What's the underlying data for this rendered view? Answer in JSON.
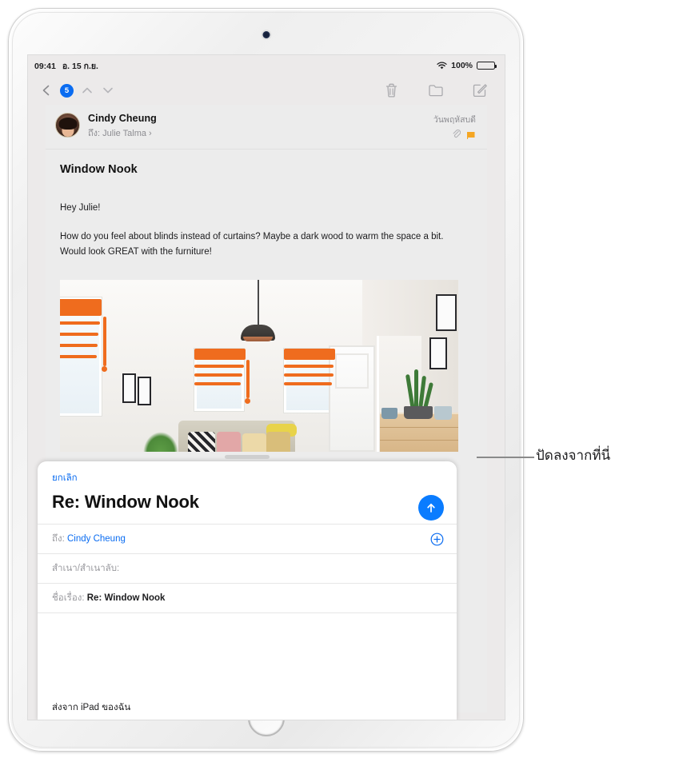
{
  "device": {
    "name": "ipad",
    "camera": "front-camera",
    "home_button": "home-button"
  },
  "status_bar": {
    "time": "09:41",
    "date": "อ. 15 ก.ย.",
    "wifi_icon": "wifi-icon",
    "battery_percent": "100%",
    "battery_icon": "battery-icon"
  },
  "toolbar": {
    "back_icon": "chevron-left-icon",
    "unread_badge": "5",
    "previous_icon": "chevron-up-icon",
    "next_icon": "chevron-down-icon",
    "trash_icon": "trash-icon",
    "folder_icon": "folder-icon",
    "compose_icon": "compose-icon"
  },
  "message": {
    "avatar": "sender-avatar",
    "sender": "Cindy Cheung",
    "to_label": "ถึง:",
    "to_name": "Julie Talma",
    "disclosure": "›",
    "date": "วันพฤหัสบดี",
    "attachment_icon": "paperclip-icon",
    "flag_icon": "flag-icon",
    "flag_color": "#f5a623",
    "subject": "Window Nook",
    "greeting": "Hey Julie!",
    "paragraph": "How do you feel about blinds instead of curtains? Maybe a dark wood to warm the space a bit. Would look GREAT with the furniture!",
    "photo_alt": "living-room-photo-with-orange-drawn-blinds"
  },
  "compose": {
    "drag_handle": "sheet-drag-handle",
    "cancel_label": "ยกเลิก",
    "title": "Re: Window Nook",
    "send_icon": "send-arrow-icon",
    "to_label": "ถึง:",
    "to_value": "Cindy Cheung",
    "add_contact_icon": "plus-circle-icon",
    "cc_bcc_label": "สำเนา/สำเนาลับ:",
    "cc_bcc_value": "",
    "subject_label": "ชื่อเรื่อง:",
    "subject_value": "Re: Window Nook",
    "signature": "ส่งจาก iPad ของฉัน",
    "accent_color": "#0a7cff"
  },
  "callout": {
    "label": "ปัดลงจากที่นี่",
    "line": "callout-leader-line"
  }
}
